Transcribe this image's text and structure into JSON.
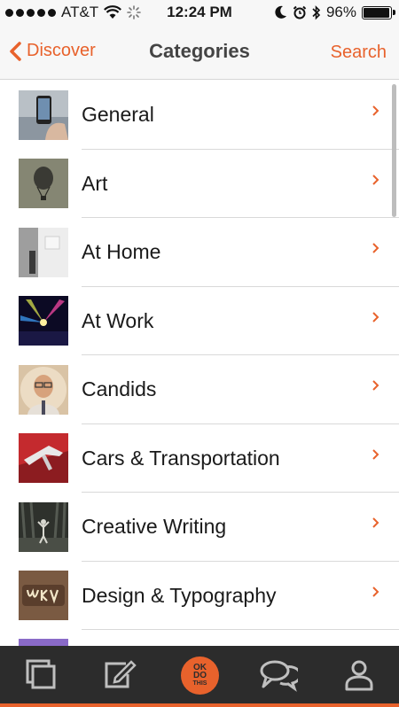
{
  "status_bar": {
    "carrier": "AT&T",
    "time": "12:24 PM",
    "battery": "96%",
    "battery_level": 0.96
  },
  "nav": {
    "back_label": "Discover",
    "title": "Categories",
    "search_label": "Search"
  },
  "categories": [
    {
      "label": "General"
    },
    {
      "label": "Art"
    },
    {
      "label": "At Home"
    },
    {
      "label": "At Work"
    },
    {
      "label": "Candids"
    },
    {
      "label": "Cars & Transportation"
    },
    {
      "label": "Creative Writing"
    },
    {
      "label": "Design & Typography"
    }
  ],
  "tab_bar": {
    "logo_lines": [
      "OK",
      "DO",
      "THIS"
    ],
    "tabs": [
      "collections-icon",
      "compose-icon",
      "okdothis-logo",
      "chat-icon",
      "profile-icon"
    ]
  },
  "colors": {
    "accent": "#e8622c",
    "tabbar_bg": "#2c2c2c",
    "tab_icon": "#bfbfbf"
  }
}
